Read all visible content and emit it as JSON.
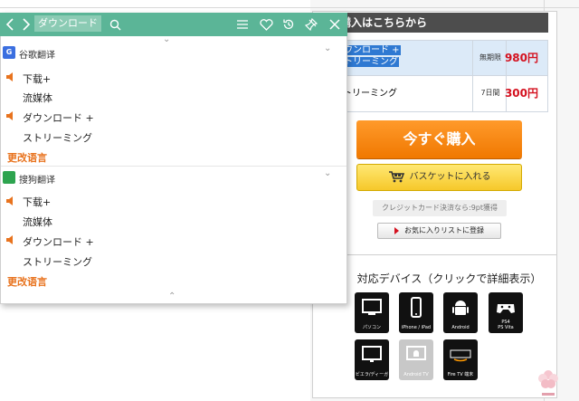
{
  "translator": {
    "search_text": "ダウンロード",
    "sections": [
      {
        "title": "谷歌翻译",
        "entries": [
          "下载+",
          "流媒体",
          "ダウンロード +",
          "ストリーミング"
        ],
        "change_language": "更改语言"
      },
      {
        "title": "搜狗翻译",
        "entries": [
          "下载+",
          "流媒体",
          "ダウンロード +",
          "ストリーミング"
        ],
        "change_language": "更改语言"
      }
    ]
  },
  "purchase": {
    "header": "購入はこちらから",
    "rows": [
      {
        "name_line1": "ウンロード +",
        "name_line2": "トリーミング",
        "period": "無期限",
        "price": "980円"
      },
      {
        "name_line1": "トリーミング",
        "name_line2": "",
        "period": "7日間",
        "price": "300円"
      }
    ],
    "buy_now": "今すぐ購入",
    "basket": "バスケットに入れる",
    "card_note": "クレジットカード決済なら:9pt獲得",
    "wishlist": "お気に入りリストに登録"
  },
  "devices": {
    "title": "対応デバイス（クリックで詳細表示）",
    "items": [
      {
        "label": "パソコン",
        "icon": "monitor-icon"
      },
      {
        "label": "iPhone / iPad",
        "icon": "phone-icon"
      },
      {
        "label": "Android",
        "icon": "android-icon"
      },
      {
        "label": "PS4\nPS Vita",
        "icon": "gamepad-icon"
      },
      {
        "label": "ビエラ/ディーガ",
        "icon": "tv-icon"
      },
      {
        "label": "Android TV",
        "icon": "android-tv-icon"
      },
      {
        "label": "Fire TV 端末",
        "icon": "amazon-icon"
      }
    ]
  },
  "colors": {
    "toolbar": "#5bb597",
    "accent_orange": "#e8731e",
    "price_red": "#d4111f",
    "buy_button": "#f07800",
    "basket_button": "#f6c82a"
  }
}
